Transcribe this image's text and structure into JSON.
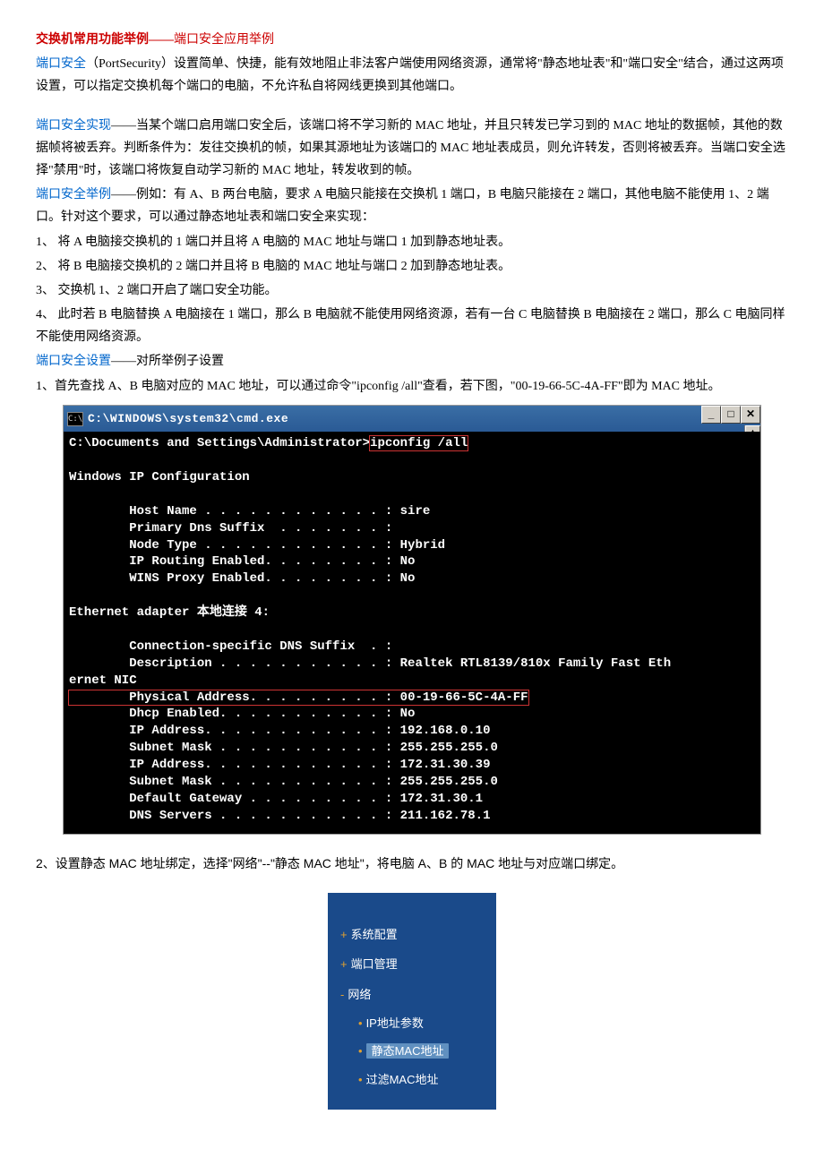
{
  "title_main": "交换机常用功能举例——",
  "title_sub": "端口安全应用举例",
  "p1_term": "端口安全",
  "p1_rest": "（PortSecurity）设置简单、快捷，能有效地阻止非法客户端使用网络资源，通常将\"静态地址表\"和\"端口安全\"结合，通过这两项设置，可以指定交换机每个端口的电脑，不允许私自将网线更换到其他端口。",
  "p2_term": "端口安全实现",
  "p2_rest": "——当某个端口启用端口安全后，该端口将不学习新的 MAC 地址，并且只转发已学习到的 MAC 地址的数据帧，其他的数据帧将被丢弃。判断条件为：发往交换机的帧，如果其源地址为该端口的 MAC 地址表成员，则允许转发，否则将被丢弃。当端口安全选择\"禁用\"时，该端口将恢复自动学习新的 MAC 地址，转发收到的帧。",
  "p3_term": "端口安全举例",
  "p3_rest": "——例如：有 A、B 两台电脑，要求 A 电脑只能接在交换机 1 端口，B 电脑只能接在 2 端口，其他电脑不能使用 1、2 端口。针对这个要求，可以通过静态地址表和端口安全来实现：",
  "li1": "1、 将 A 电脑接交换机的 1 端口并且将 A 电脑的 MAC 地址与端口 1 加到静态地址表。",
  "li2": "2、 将 B 电脑接交换机的 2 端口并且将 B 电脑的 MAC 地址与端口 2 加到静态地址表。",
  "li3": "3、 交换机 1、2 端口开启了端口安全功能。",
  "li4": "4、 此时若 B 电脑替换 A 电脑接在 1 端口，那么 B 电脑就不能使用网络资源，若有一台 C 电脑替换 B 电脑接在 2 端口，那么 C 电脑同样不能使用网络资源。",
  "p4_term": "端口安全设置",
  "p4_rest": "——对所举例子设置",
  "step1": "1、首先查找 A、B 电脑对应的 MAC 地址，可以通过命令\"ipconfig /all\"查看，若下图，\"00-19-66-5C-4A-FF\"即为 MAC 地址。",
  "cmd": {
    "title": "C:\\WINDOWS\\system32\\cmd.exe",
    "icon": "C:\\",
    "btn_min": "_",
    "btn_max": "□",
    "btn_close": "✕",
    "scroll_up": "▲",
    "prompt_pre": "C:\\Documents and Settings\\Administrator>",
    "prompt_cmd": "ipconfig /all",
    "l_blank": "",
    "l_winip": "Windows IP Configuration",
    "l_host": "        Host Name . . . . . . . . . . . . : sire",
    "l_dns": "        Primary Dns Suffix  . . . . . . . :",
    "l_node": "        Node Type . . . . . . . . . . . . : Hybrid",
    "l_iprt": "        IP Routing Enabled. . . . . . . . : No",
    "l_wins": "        WINS Proxy Enabled. . . . . . . . : No",
    "l_eth": "Ethernet adapter 本地连接 4:",
    "l_csd": "        Connection-specific DNS Suffix  . :",
    "l_desc": "        Description . . . . . . . . . . . : Realtek RTL8139/810x Family Fast Eth",
    "l_ernet": "ernet NIC",
    "l_phys_pre": "        Physical Address. . . . . . . . . : ",
    "l_phys_val": "00-19-66-5C-4A-FF",
    "l_dhcp": "        Dhcp Enabled. . . . . . . . . . . : No",
    "l_ip1": "        IP Address. . . . . . . . . . . . : 192.168.0.10",
    "l_sm1": "        Subnet Mask . . . . . . . . . . . : 255.255.255.0",
    "l_ip2": "        IP Address. . . . . . . . . . . . : 172.31.30.39",
    "l_sm2": "        Subnet Mask . . . . . . . . . . . : 255.255.255.0",
    "l_gw": "        Default Gateway . . . . . . . . . : 172.31.30.1",
    "l_dnss": "        DNS Servers . . . . . . . . . . . : 211.162.78.1"
  },
  "step2": "2、设置静态 MAC 地址绑定，选择\"网络\"--\"静态 MAC 地址\"，将电脑 A、B 的 MAC 地址与对应端口绑定。",
  "nav": {
    "sys": "系统配置",
    "port": "端口管理",
    "net": "网络",
    "ip": "IP地址参数",
    "static": "静态MAC地址",
    "filter": "过滤MAC地址"
  }
}
